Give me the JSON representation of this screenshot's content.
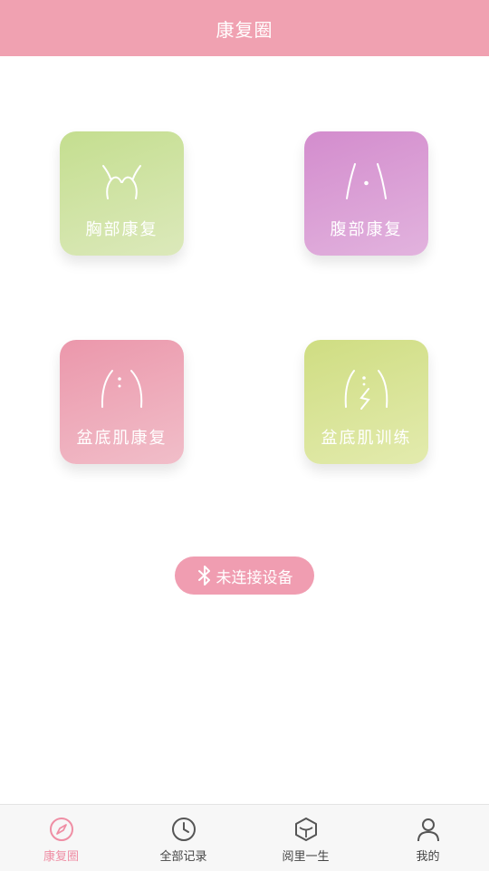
{
  "header": {
    "title": "康复圈"
  },
  "tiles": [
    {
      "label": "胸部康复",
      "icon": "chest-icon"
    },
    {
      "label": "腹部康复",
      "icon": "abdomen-icon"
    },
    {
      "label": "盆底肌康复",
      "icon": "pelvic-floor-icon"
    },
    {
      "label": "盆底肌训练",
      "icon": "pelvic-training-icon"
    }
  ],
  "bluetooth": {
    "label": "未连接设备",
    "icon": "bluetooth-icon"
  },
  "tabbar": {
    "active_index": 0,
    "active_color": "#ef8ea4",
    "items": [
      {
        "label": "康复圈",
        "icon": "compass-icon"
      },
      {
        "label": "全部记录",
        "icon": "clock-icon"
      },
      {
        "label": "阅里一生",
        "icon": "box-icon"
      },
      {
        "label": "我的",
        "icon": "user-icon"
      }
    ]
  },
  "colors": {
    "header": "#f0a1b1",
    "chest_tile": "#c4de8f",
    "abdomen_tile": "#d38ccd",
    "pelvic_tile": "#eb97ab",
    "training_tile": "#cfdd82",
    "bluetooth_button": "#f09db1"
  }
}
